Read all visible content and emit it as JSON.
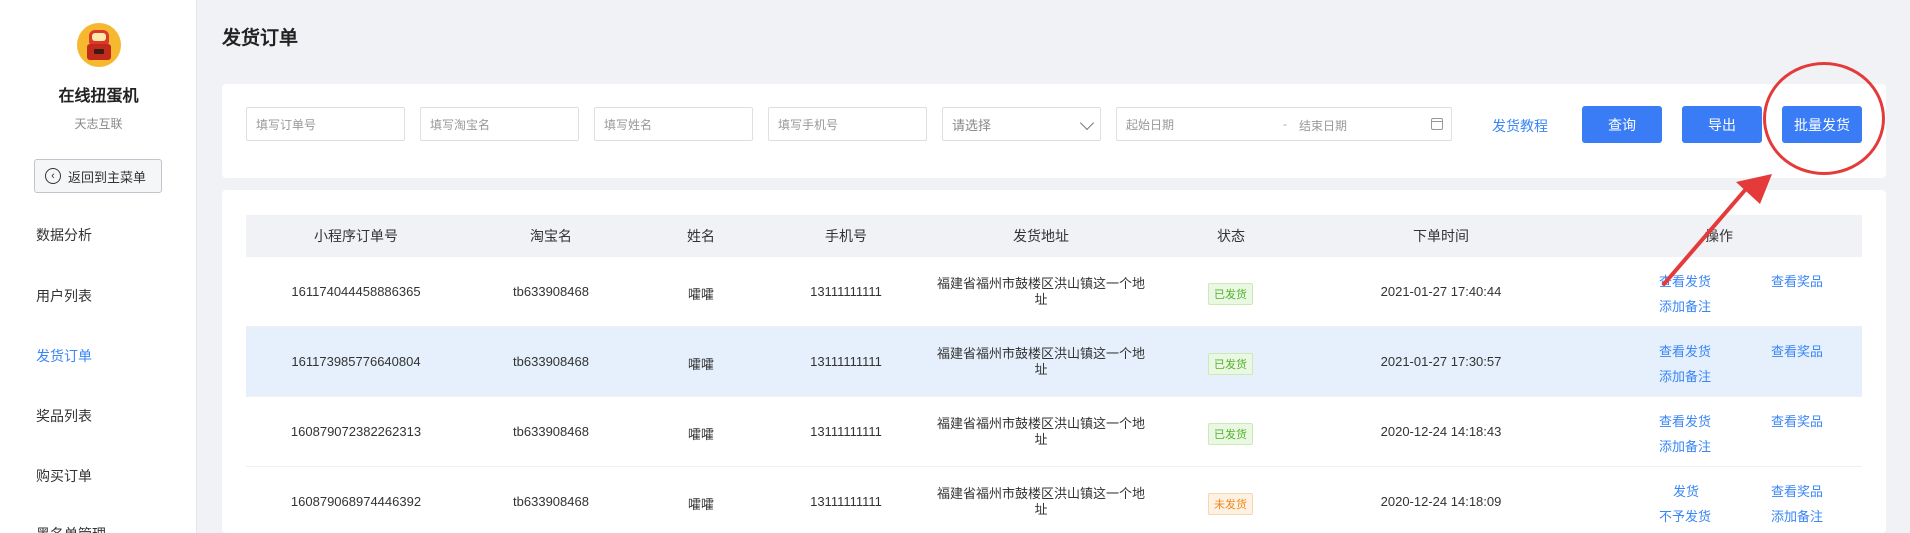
{
  "sidebar": {
    "app_name": "在线扭蛋机",
    "app_sub": "天志互联",
    "back_label": "返回到主菜单",
    "items": [
      {
        "label": "数据分析"
      },
      {
        "label": "用户列表"
      },
      {
        "label": "发货订单"
      },
      {
        "label": "奖品列表"
      },
      {
        "label": "购买订单"
      },
      {
        "label": "黑名单管理"
      }
    ],
    "active_index": 2
  },
  "header": {
    "title": "发货订单"
  },
  "filters": {
    "order_no_placeholder": "填写订单号",
    "taobao_placeholder": "填写淘宝名",
    "name_placeholder": "填写姓名",
    "phone_placeholder": "填写手机号",
    "select_placeholder": "请选择",
    "start_date_placeholder": "起始日期",
    "date_separator": "-",
    "end_date_placeholder": "结束日期",
    "tutorial_label": "发货教程",
    "query_label": "查询",
    "export_label": "导出",
    "batch_ship_label": "批量发货"
  },
  "table": {
    "columns": [
      "小程序订单号",
      "淘宝名",
      "姓名",
      "手机号",
      "发货地址",
      "状态",
      "下单时间",
      "操作"
    ],
    "rows": [
      {
        "order_no": "161174044458886365",
        "taobao": "tb633908468",
        "name": "嚯嚯",
        "phone": "13111111111",
        "address": "福建省福州市鼓楼区洪山镇这一个地址",
        "status": "已发货",
        "status_type": "ok",
        "time": "2021-01-27 17:40:44",
        "op1": "查看发货",
        "op2": "查看奖品",
        "op3": "添加备注"
      },
      {
        "order_no": "161173985776640804",
        "taobao": "tb633908468",
        "name": "嚯嚯",
        "phone": "13111111111",
        "address": "福建省福州市鼓楼区洪山镇这一个地址",
        "status": "已发货",
        "status_type": "ok",
        "time": "2021-01-27 17:30:57",
        "op1": "查看发货",
        "op2": "查看奖品",
        "op3": "添加备注"
      },
      {
        "order_no": "160879072382262313",
        "taobao": "tb633908468",
        "name": "嚯嚯",
        "phone": "13111111111",
        "address": "福建省福州市鼓楼区洪山镇这一个地址",
        "status": "已发货",
        "status_type": "ok",
        "time": "2020-12-24 14:18:43",
        "op1": "查看发货",
        "op2": "查看奖品",
        "op3": "添加备注"
      },
      {
        "order_no": "160879068974446392",
        "taobao": "tb633908468",
        "name": "嚯嚯",
        "phone": "13111111111",
        "address": "福建省福州市鼓楼区洪山镇这一个地址",
        "status": "未发货",
        "status_type": "pending",
        "time": "2020-12-24 14:18:09",
        "op1": "发货",
        "op2": "查看奖品",
        "op3": "不予发货",
        "op4": "添加备注"
      }
    ]
  },
  "colors": {
    "accent": "#3a7cf5",
    "annotation": "#e53a3a",
    "ok": "#52b22a",
    "pending": "#ee8a1c"
  }
}
